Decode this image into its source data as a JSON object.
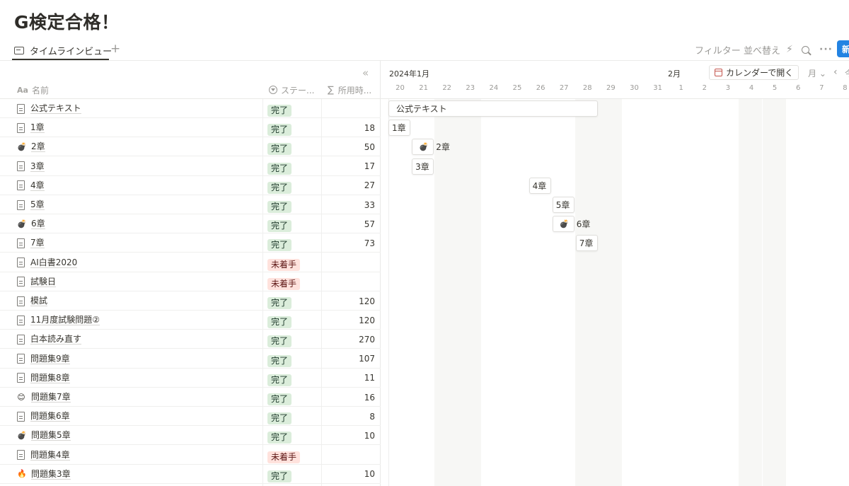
{
  "page": {
    "title": "G検定合格！"
  },
  "tabs": {
    "active_label": "タイムラインビュー",
    "add_label": "+"
  },
  "toolbar": {
    "filter": "フィルター",
    "sort": "並べ替え",
    "bolt_icon": "⚡",
    "more": "···",
    "new_label": "新"
  },
  "table": {
    "collapse_icon": "«",
    "headers": {
      "name_prefix": "Aa",
      "name": "名前",
      "status": "ステー...",
      "time_prefix": "∑",
      "time": "所用時..."
    },
    "rows": [
      {
        "icon": "doc-icon",
        "name": "公式テキスト",
        "status": "完了",
        "status_kind": "done",
        "time": ""
      },
      {
        "icon": "doc-icon",
        "name": "1章",
        "status": "完了",
        "status_kind": "done",
        "time": "18"
      },
      {
        "icon": "bomb-icon",
        "emoji": "💣",
        "name": "2章",
        "status": "完了",
        "status_kind": "done",
        "time": "50"
      },
      {
        "icon": "doc-icon",
        "name": "3章",
        "status": "完了",
        "status_kind": "done",
        "time": "17"
      },
      {
        "icon": "doc-icon",
        "name": "4章",
        "status": "完了",
        "status_kind": "done",
        "time": "27"
      },
      {
        "icon": "doc-icon",
        "name": "5章",
        "status": "完了",
        "status_kind": "done",
        "time": "33"
      },
      {
        "icon": "bomb-icon",
        "emoji": "💣",
        "name": "6章",
        "status": "完了",
        "status_kind": "done",
        "time": "57"
      },
      {
        "icon": "doc-icon",
        "name": "7章",
        "status": "完了",
        "status_kind": "done",
        "time": "73"
      },
      {
        "icon": "doc-icon",
        "name": "AI白書2020",
        "status": "未着手",
        "status_kind": "todo",
        "time": ""
      },
      {
        "icon": "doc-icon",
        "name": "試験日",
        "status": "未着手",
        "status_kind": "todo",
        "time": ""
      },
      {
        "icon": "doc-icon",
        "name": "模試",
        "status": "完了",
        "status_kind": "done",
        "time": "120"
      },
      {
        "icon": "doc-icon",
        "name": "11月度試験問題②",
        "status": "完了",
        "status_kind": "done",
        "time": "120"
      },
      {
        "icon": "doc-icon",
        "name": "白本読み直す",
        "status": "完了",
        "status_kind": "done",
        "time": "270"
      },
      {
        "icon": "doc-icon",
        "name": "問題集9章",
        "status": "完了",
        "status_kind": "done",
        "time": "107"
      },
      {
        "icon": "doc-icon",
        "name": "問題集8章",
        "status": "完了",
        "status_kind": "done",
        "time": "11"
      },
      {
        "icon": "smile-icon",
        "emoji": "😊",
        "name": "問題集7章",
        "status": "完了",
        "status_kind": "done",
        "time": "16"
      },
      {
        "icon": "doc-icon",
        "name": "問題集6章",
        "status": "完了",
        "status_kind": "done",
        "time": "8"
      },
      {
        "icon": "bomb-icon",
        "emoji": "💣",
        "name": "問題集5章",
        "status": "完了",
        "status_kind": "done",
        "time": "10"
      },
      {
        "icon": "doc-icon",
        "name": "問題集4章",
        "status": "未着手",
        "status_kind": "todo",
        "time": ""
      },
      {
        "icon": "fire-icon",
        "emoji": "🔥",
        "name": "問題集3章",
        "status": "完了",
        "status_kind": "done",
        "time": "10"
      }
    ]
  },
  "timeline": {
    "month_jan": "2024年1月",
    "month_feb": "2月",
    "open_calendar": "カレンダーで開く",
    "mode": "月 ⌄",
    "prev": "‹",
    "today": "今",
    "days": [
      "20",
      "21",
      "22",
      "23",
      "24",
      "25",
      "26",
      "27",
      "28",
      "29",
      "30",
      "31",
      "1",
      "2",
      "3",
      "4",
      "5",
      "6",
      "7",
      "8"
    ],
    "weekend_day_indexes": [
      1,
      7,
      14
    ],
    "bars": [
      {
        "row": 0,
        "start": 0,
        "end": 9,
        "label": "公式テキスト",
        "emoji": ""
      },
      {
        "row": 1,
        "start": 0,
        "end": 1,
        "label": "1章",
        "emoji": ""
      },
      {
        "row": 2,
        "start": 1,
        "end": 2,
        "label": "2章",
        "emoji": "💣"
      },
      {
        "row": 3,
        "start": 1,
        "end": 2,
        "label": "3章",
        "emoji": ""
      },
      {
        "row": 4,
        "start": 6,
        "end": 7,
        "label": "4章",
        "emoji": ""
      },
      {
        "row": 5,
        "start": 7,
        "end": 8,
        "label": "5章",
        "emoji": ""
      },
      {
        "row": 6,
        "start": 7,
        "end": 8,
        "label": "6章",
        "emoji": "💣"
      },
      {
        "row": 7,
        "start": 8,
        "end": 9,
        "label": "7章",
        "emoji": ""
      }
    ]
  }
}
